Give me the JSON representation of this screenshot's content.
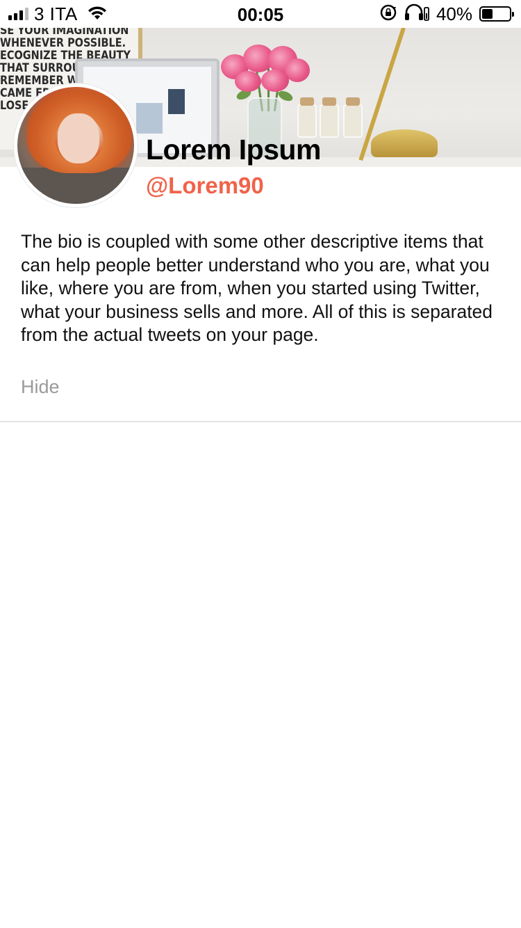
{
  "status_bar": {
    "carrier": "3 ITA",
    "time": "00:05",
    "battery_percent_text": "40%",
    "battery_level": 0.4,
    "icons": [
      "signal-icon",
      "wifi-icon",
      "orientation-lock-icon",
      "headphones-icon",
      "battery-icon"
    ]
  },
  "header": {
    "banner_poster_lines": [
      "SE YOUR IMAGINATION",
      "WHENEVER POSSIBLE.",
      "ECOGNIZE THE BEAUTY",
      "THAT SURROUND",
      "REMEMBER WHI",
      "CAME FROM",
      "LOSE S"
    ]
  },
  "profile": {
    "display_name": "Lorem Ipsum",
    "username": "@Lorem90",
    "bio": "The bio is coupled with some other descriptive items that can help people better understand who you are, what you like, where you are from, when you started using Twitter, what your business sells and more. All of this is separated from the actual tweets on your page.",
    "hide_label": "Hide"
  },
  "colors": {
    "accent": "#f0634a",
    "muted_text": "#9a9a9a",
    "divider": "#e4e4e4"
  }
}
